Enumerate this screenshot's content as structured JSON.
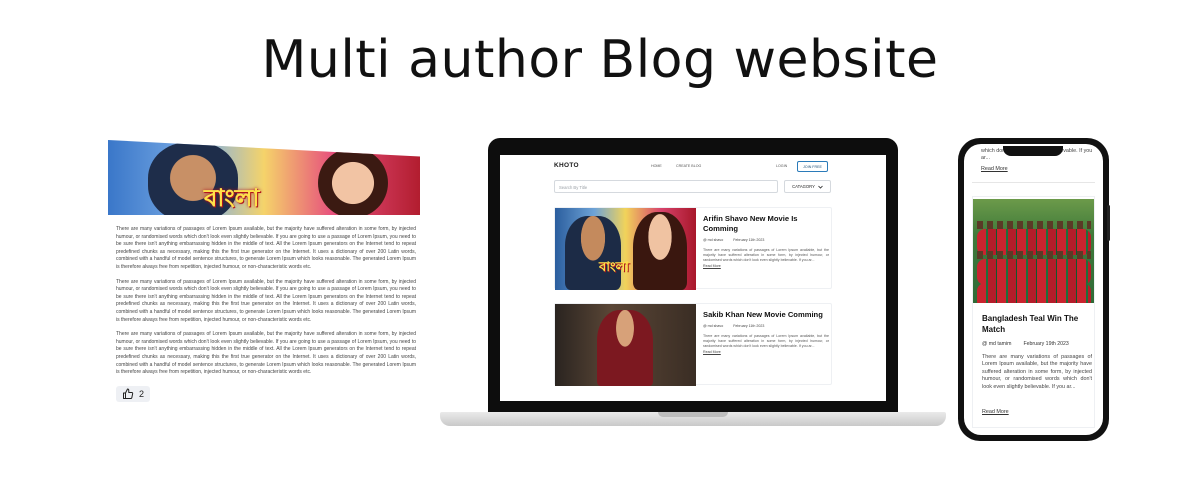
{
  "hero": {
    "title": "Multi author Blog website"
  },
  "detail": {
    "paragraphs": [
      "There are many variations of passages of Lorem Ipsum available, but the majority have suffered alteration in some form, by injected humour, or randomised words which don't look even slightly believable. If you are going to use a passage of Lorem Ipsum, you need to be sure there isn't anything embarrassing hidden in the middle of text. All the Lorem Ipsum generators on the Internet tend to repeat predefined chunks as necessary, making this the first true generator on the Internet. It uses a dictionary of over 200 Latin words, combined with a handful of model sentence structures, to generate Lorem Ipsum which looks reasonable. The generated Lorem Ipsum is therefore always free from repetition, injected humour, or non-characteristic words etc.",
      "There are many variations of passages of Lorem Ipsum available, but the majority have suffered alteration in some form, by injected humour, or randomised words which don't look even slightly believable. If you are going to use a passage of Lorem Ipsum, you need to be sure there isn't anything embarrassing hidden in the middle of text. All the Lorem Ipsum generators on the Internet tend to repeat predefined chunks as necessary, making this the first true generator on the Internet. It uses a dictionary of over 200 Latin words, combined with a handful of model sentence structures, to generate Lorem Ipsum which looks reasonable. The generated Lorem Ipsum is therefore always free from repetition, injected humour, or non-characteristic words etc.",
      "There are many variations of passages of Lorem Ipsum available, but the majority have suffered alteration in some form, by injected humour, or randomised words which don't look even slightly believable. If you are going to use a passage of Lorem Ipsum, you need to be sure there isn't anything embarrassing hidden in the middle of text. All the Lorem Ipsum generators on the Internet tend to repeat predefined chunks as necessary, making this the first true generator on the Internet. It uses a dictionary of over 200 Latin words, combined with a handful of model sentence structures, to generate Lorem Ipsum which looks reasonable. The generated Lorem Ipsum is therefore always free from repetition, injected humour, or non-characteristic words etc."
    ],
    "banner_text": "বাংলা",
    "like_icon": "thumbs-up-icon",
    "like_count": "2"
  },
  "laptop": {
    "brand": "KHOTO",
    "nav": {
      "home": "HOME",
      "create_blog": "CREATE BLOG",
      "login": "LOGIN",
      "join": "JOIN FREE"
    },
    "search": {
      "placeholder": "Search By Title"
    },
    "category": {
      "label": "CATAGORY",
      "icon": "chevron-down-icon"
    },
    "posts": [
      {
        "title": "Arifin Shavo New Movie Is Comming",
        "author": "@ md shavo",
        "date": "February 11th 2023",
        "excerpt": "There are many variations of passages of Lorem Ipsum available, but the majority have suffered alteration in some form, by injected humour, or randomised words which don't look even slightly believable. If you ar...",
        "read_more": "Read More",
        "image_text": "বাংলা"
      },
      {
        "title": "Sakib Khan New Movie Comming",
        "author": "@ md shavo",
        "date": "February 11th 2023",
        "excerpt": "There are many variations of passages of Lorem Ipsum available, but the majority have suffered alteration in some form, by injected humour, or randomised words which don't look even slightly believable. If you ar...",
        "read_more": "Read More"
      }
    ]
  },
  "phone": {
    "top_excerpt": "which don't look even slightly believable. If you ar...",
    "top_read_more": "Read More",
    "post": {
      "title": "Bangladesh Teal Win The Match",
      "author": "@ md tamim",
      "date": "February 19th 2023",
      "excerpt": "There are many variations of passages of Lorem Ipsum available, but the majority have suffered alteration in some form, by injected humour, or randomised words which don't look even slightly believable. If you ar...",
      "read_more": "Read More"
    }
  }
}
